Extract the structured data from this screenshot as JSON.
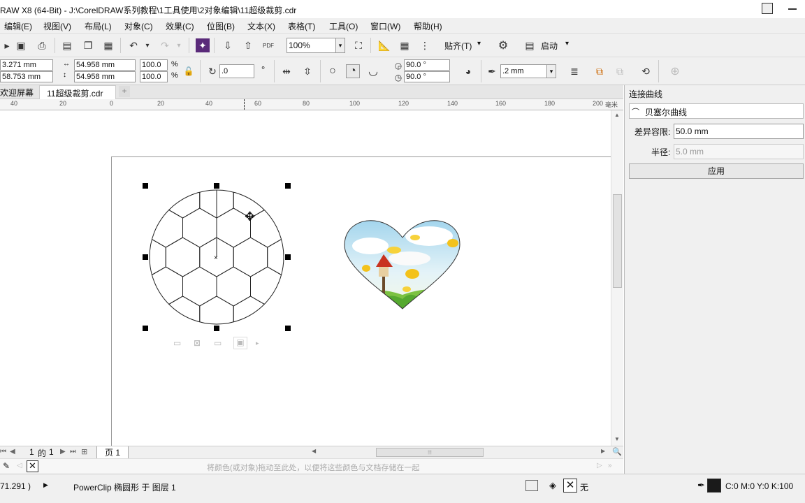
{
  "window": {
    "title": "RAW X8 (64-Bit) - J:\\CorelDRAW系列教程\\1工具使用\\2对象编辑\\11超级裁剪.cdr"
  },
  "menu": [
    "编辑(E)",
    "视图(V)",
    "布局(L)",
    "对象(C)",
    "效果(C)",
    "位图(B)",
    "文本(X)",
    "表格(T)",
    "工具(O)",
    "窗口(W)",
    "帮助(H)"
  ],
  "toolbar": {
    "zoom": "100%",
    "snap_label": "贴齐(T)",
    "launch_label": "启动"
  },
  "property_bar": {
    "x": "3.271 mm",
    "y": "58.753 mm",
    "width": "54.958 mm",
    "height": "54.958 mm",
    "scale_x": "100.0",
    "scale_y": "100.0",
    "percent": "%",
    "rotation": ".0",
    "degree": "°",
    "start_angle": "90.0 °",
    "end_angle": "90.0 °",
    "outline_width": ".2 mm"
  },
  "tabs": {
    "welcome": "欢迎屏幕",
    "document": "11超级裁剪.cdr"
  },
  "ruler": {
    "labels": [
      "40",
      "20",
      "0",
      "20",
      "40",
      "60",
      "80",
      "100",
      "120",
      "140",
      "160",
      "180",
      "200"
    ],
    "unit": "毫米"
  },
  "docker": {
    "title": "连接曲线",
    "mode": "贝塞尔曲线",
    "tolerance_label": "差异容限:",
    "tolerance_value": "50.0 mm",
    "radius_label": "半径:",
    "radius_value": "5.0 mm",
    "apply_label": "应用"
  },
  "page_nav": {
    "current": "1",
    "of": "的",
    "total": "1",
    "page_tab": "页 1"
  },
  "palette_hint": "将颜色(或对象)拖动至此处，以便将这些颜色与文档存储在一起",
  "status": {
    "coords": "71.291 )",
    "object_info": "PowerClip 椭圆形 于 图层 1",
    "fill_none": "无",
    "color": "C:0 M:0 Y:0 K:100",
    "color_swatch": "#1a1a1a"
  }
}
